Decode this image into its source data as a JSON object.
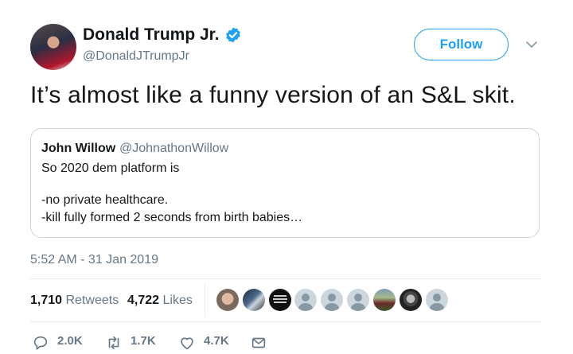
{
  "tweet": {
    "author": {
      "name": "Donald Trump Jr.",
      "handle": "@DonaldJTrumpJr",
      "verified": true,
      "avatar_icon": "profile-photo"
    },
    "follow_label": "Follow",
    "text": "It’s almost like a funny version of an S&L skit.",
    "quoted": {
      "name": "John Willow",
      "handle": "@JohnathonWillow",
      "lines": [
        "So 2020 dem platform is",
        "",
        "-no private healthcare.",
        "-kill fully formed 2 seconds from birth babies…"
      ]
    },
    "timestamp": "5:52 AM - 31 Jan 2019",
    "stats": {
      "retweets_count": "1,710",
      "retweets_label": "Retweets",
      "likes_count": "4,722",
      "likes_label": "Likes"
    },
    "likers_count_shown": 10,
    "actions": {
      "replies": "2.0K",
      "retweets": "1.7K",
      "likes": "4.7K"
    }
  },
  "colors": {
    "brand_blue": "#1da1f2",
    "secondary_text": "#657786",
    "border": "#ccd6dd"
  }
}
